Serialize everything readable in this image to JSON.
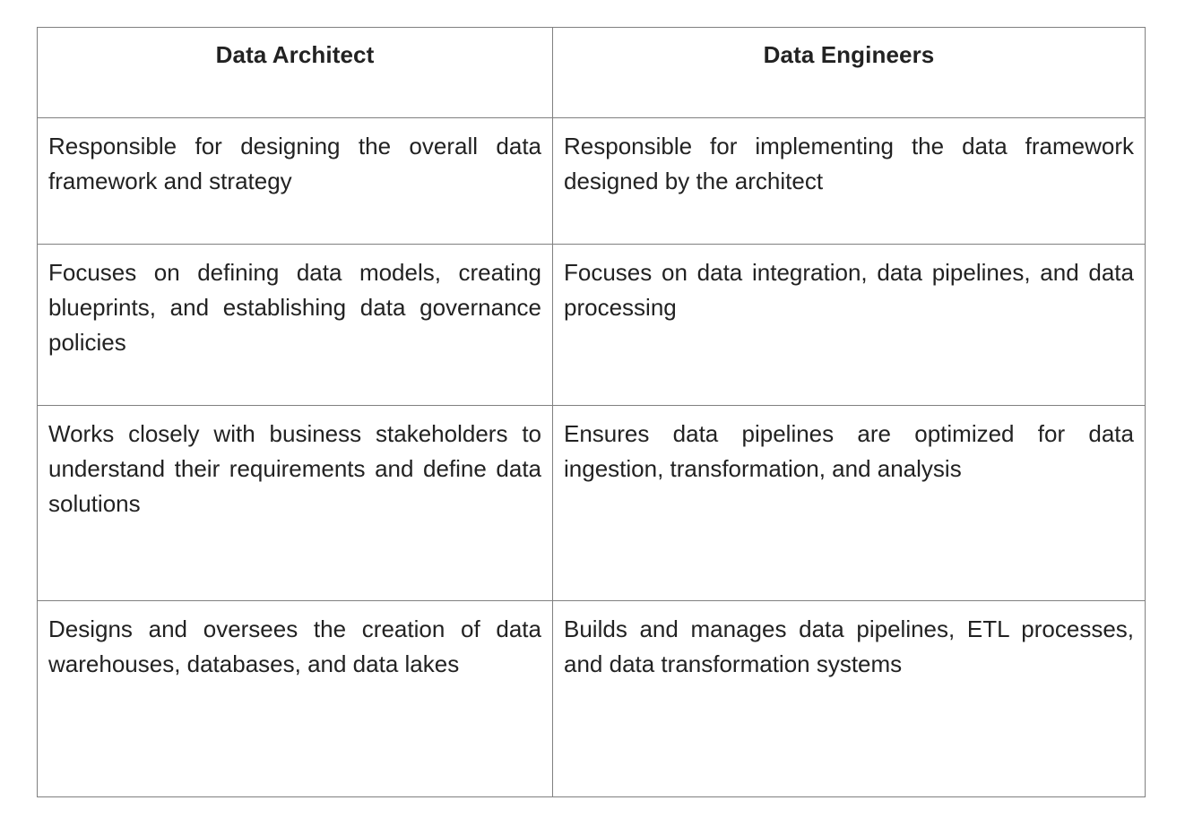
{
  "table": {
    "columns": [
      {
        "header": "Data Architect"
      },
      {
        "header": "Data Engineers"
      }
    ],
    "rows": [
      {
        "left": "Responsible for designing the overall data framework and strategy",
        "right": "Responsible for implementing the data framework designed by the architect"
      },
      {
        "left": "Focuses on defining data models, creating blueprints, and establishing data governance policies",
        "right": "Focuses on data integration, data pipelines, and data processing"
      },
      {
        "left": "Works closely with business stakeholders to understand their requirements and define data solutions",
        "right": "Ensures data pipelines are optimized for data ingestion, transformation, and analysis"
      },
      {
        "left": "Designs and oversees the creation of data warehouses, databases, and data lakes",
        "right": "Builds and manages data pipelines, ETL processes, and data transformation systems"
      }
    ]
  },
  "style": {
    "border_color": "#808080",
    "text_color": "#222222",
    "background": "#ffffff"
  }
}
